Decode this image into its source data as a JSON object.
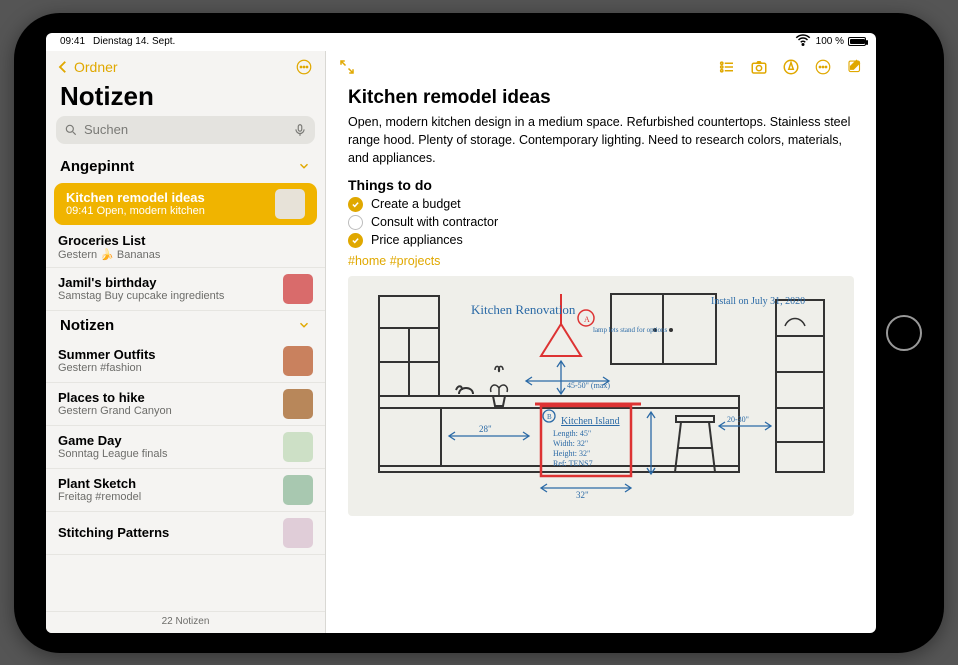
{
  "status": {
    "time": "09:41",
    "date": "Dienstag 14. Sept.",
    "wifi": "wifi",
    "battery_pct": "100 %"
  },
  "sidebar": {
    "back_label": "Ordner",
    "heading": "Notizen",
    "search_placeholder": "Suchen",
    "footer": "22 Notizen",
    "sections": [
      {
        "title": "Angepinnt",
        "items": [
          {
            "title": "Kitchen remodel ideas",
            "time": "09:41",
            "snippet": "Open, modern kitchen",
            "selected": true,
            "thumb": "#e7e2d8"
          },
          {
            "title": "Groceries List",
            "time": "Gestern",
            "snippet": "🍌 Bananas",
            "thumb": ""
          },
          {
            "title": "Jamil's birthday",
            "time": "Samstag",
            "snippet": "Buy cupcake ingredients",
            "thumb": "#d96b6b"
          }
        ]
      },
      {
        "title": "Notizen",
        "items": [
          {
            "title": "Summer Outfits",
            "time": "Gestern",
            "snippet": "#fashion",
            "thumb": "#c9815e"
          },
          {
            "title": "Places to hike",
            "time": "Gestern",
            "snippet": "Grand Canyon",
            "thumb": "#b8875a"
          },
          {
            "title": "Game Day",
            "time": "Sonntag",
            "snippet": "League finals",
            "thumb": "#cde0c6"
          },
          {
            "title": "Plant Sketch",
            "time": "Freitag",
            "snippet": "#remodel",
            "thumb": "#a8c8b0"
          },
          {
            "title": "Stitching Patterns",
            "time": "",
            "snippet": "",
            "thumb": "#e0cdd8"
          }
        ]
      }
    ]
  },
  "note": {
    "title": "Kitchen remodel ideas",
    "description": "Open, modern kitchen design in a medium space. Refurbished countertops. Stainless steel range hood. Plenty of storage. Contemporary lighting. Need to research colors, materials, and appliances.",
    "todo_heading": "Things to do",
    "todos": [
      {
        "label": "Create a budget",
        "done": true
      },
      {
        "label": "Consult with contractor",
        "done": false
      },
      {
        "label": "Price appliances",
        "done": true
      }
    ],
    "tags": "#home #projects",
    "sketch": {
      "title_script": "Kitchen Renovation",
      "install_note": "Install on July 31, 2020",
      "island_label": "Kitchen Island",
      "dims_lines": [
        "Length: 45\"",
        "Width: 32\"",
        "Height: 32\"",
        "Ref: TENS7"
      ],
      "dim_45_50": "45-50\" (max)",
      "dim_28": "28\"",
      "dim_32": "32\"",
      "dim_20_30": "20-30\"",
      "lamp_note": "lamp lets stand for options"
    }
  },
  "colors": {
    "accent": "#e0a800"
  }
}
